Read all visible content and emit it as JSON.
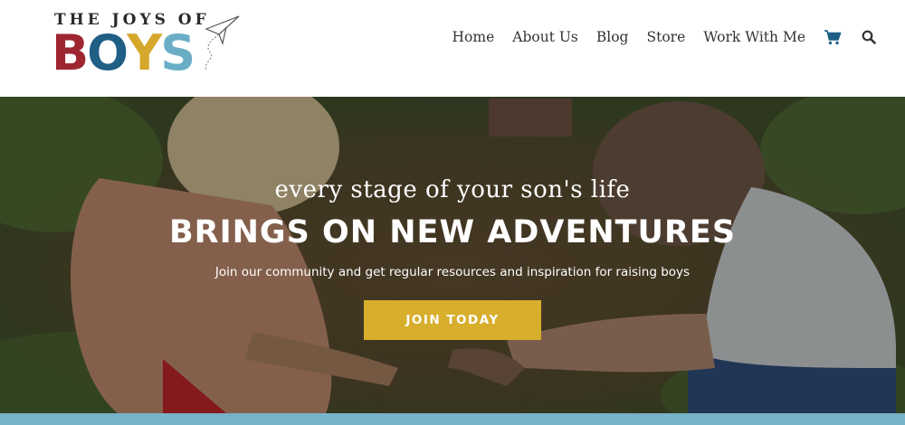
{
  "header": {
    "logo": {
      "tagline": "THE JOYS OF",
      "letters": [
        {
          "char": "B",
          "color": "#9e2630"
        },
        {
          "char": "O",
          "color": "#1f5f86"
        },
        {
          "char": "Y",
          "color": "#d5a82b"
        },
        {
          "char": "S",
          "color": "#6aaec6"
        }
      ]
    },
    "nav": {
      "items": [
        {
          "label": "Home"
        },
        {
          "label": "About Us"
        },
        {
          "label": "Blog"
        },
        {
          "label": "Store"
        },
        {
          "label": "Work With Me"
        }
      ],
      "cart_icon": "cart-icon",
      "search_icon": "search-icon",
      "cart_color": "#1f5f86"
    }
  },
  "hero": {
    "script_line": "every stage of your son's life",
    "headline": "BRINGS ON NEW ADVENTURES",
    "subtext": "Join our community and get regular resources and inspiration for raising boys",
    "cta_label": "JOIN TODAY",
    "cta_color": "#d8ae2d"
  },
  "footer_strip_color": "#78b2c8"
}
